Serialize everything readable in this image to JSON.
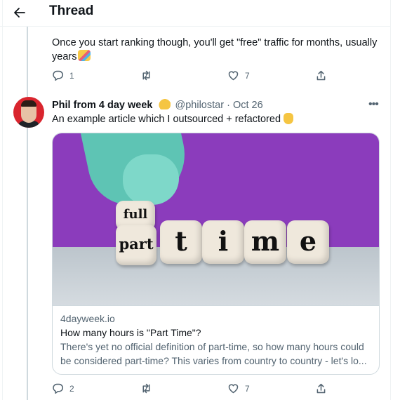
{
  "header": {
    "back_icon": "arrow-left-icon",
    "title": "Thread"
  },
  "tweet1": {
    "text_line1": "Once you start ranking though, you'll get \"free\" traffic for months, usually",
    "text_line2": "years",
    "emoji": "party-face-emoji",
    "actions": {
      "reply_count": "1",
      "retweet_count": "",
      "like_count": "7"
    }
  },
  "tweet2": {
    "author": "Phil from 4 day week",
    "author_emoji": "waving-hand-emoji",
    "handle": "@philostar",
    "separator": "·",
    "date": "Oct 26",
    "more_icon": "more-dots-icon",
    "text": "An example article which I outsourced + refactored",
    "text_emoji": "pointing-down-emoji",
    "card": {
      "image_dice": [
        "full",
        "part",
        "t",
        "i",
        "m",
        "e"
      ],
      "domain": "4dayweek.io",
      "title": "How many hours is \"Part Time\"?",
      "description_line1": "There's yet no official definition of part-time, so how many hours could",
      "description_line2": "be considered part-time? This varies from country to country - let's lo..."
    },
    "actions": {
      "reply_count": "2",
      "retweet_count": "",
      "like_count": "7"
    }
  },
  "colors": {
    "text": "#0f1419",
    "muted": "#536471",
    "border": "#cfd9de",
    "avatar_bg": "#d9252e",
    "card_image_bg": "#8b3cbc"
  }
}
